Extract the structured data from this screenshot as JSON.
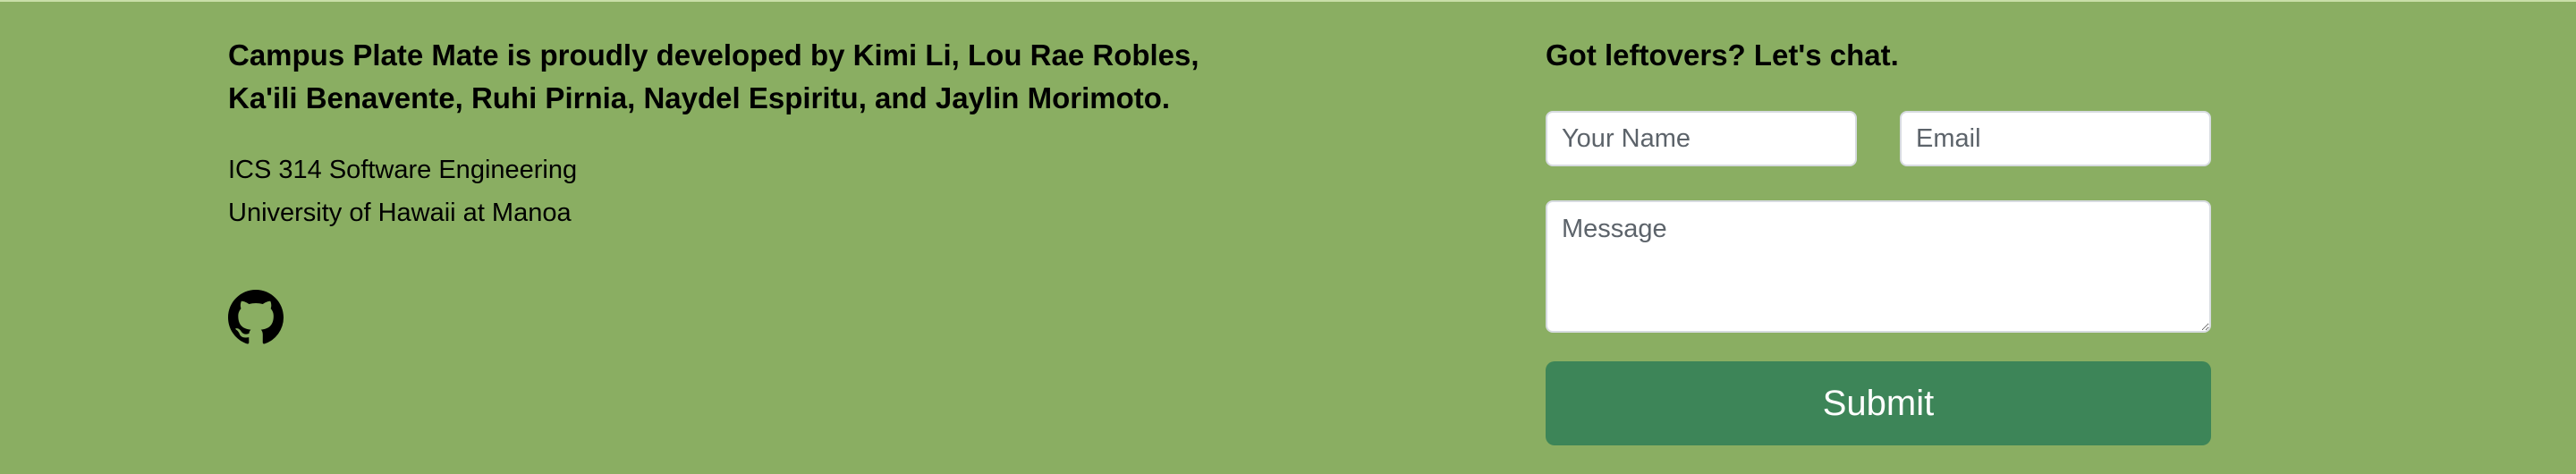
{
  "footer": {
    "credits_line1": "Campus Plate Mate is proudly developed by Kimi Li, Lou Rae Robles,",
    "credits_line2": "Ka'ili Benavente, Ruhi Pirnia, Naydel Espiritu, and Jaylin Morimoto.",
    "course": "ICS 314 Software Engineering",
    "university": "University of Hawaii at Manoa",
    "github_icon": "github-icon"
  },
  "contact": {
    "title": "Got leftovers? Let's chat.",
    "name_placeholder": "Your Name",
    "email_placeholder": "Email",
    "message_placeholder": "Message",
    "submit_label": "Submit"
  },
  "colors": {
    "background": "#8aae62",
    "submit_button": "#3d8558",
    "text": "#000000"
  }
}
